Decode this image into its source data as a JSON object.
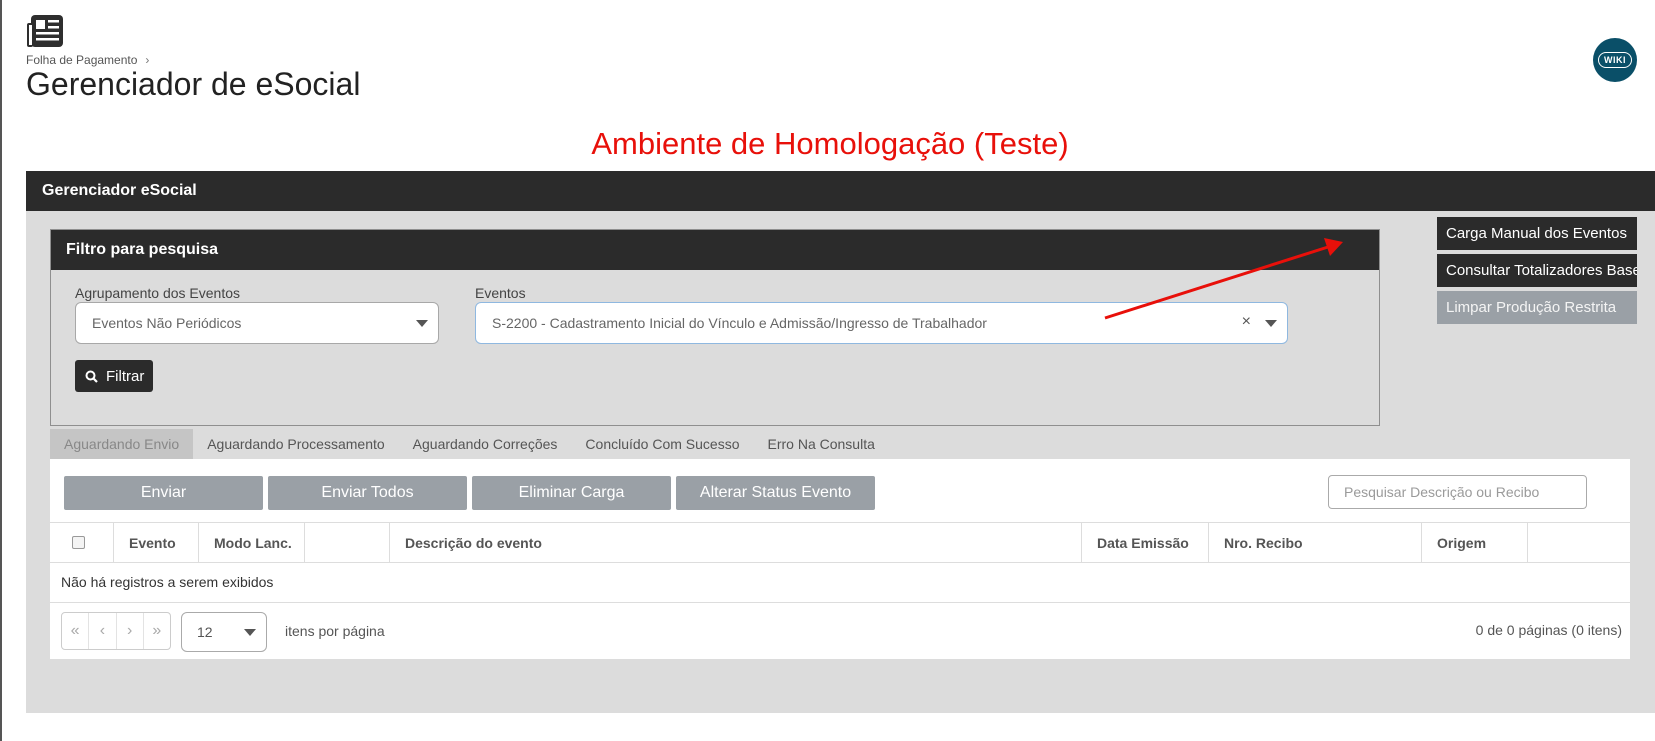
{
  "header": {
    "icon": "newspaper-icon",
    "breadcrumb": "Folha de Pagamento",
    "breadcrumb_separator": "›",
    "title": "Gerenciador de eSocial",
    "wiki_label": "WIKI"
  },
  "environment_banner": "Ambiente de Homologação (Teste)",
  "panel": {
    "title": "Gerenciador eSocial",
    "filter": {
      "title": "Filtro para pesquisa",
      "grouping_label": "Agrupamento dos Eventos",
      "grouping_value": "Eventos Não Periódicos",
      "events_label": "Eventos",
      "events_value": "S-2200 - Cadastramento Inicial do Vínculo e Admissão/Ingresso de Trabalhador",
      "clear_symbol": "×",
      "filter_button": "Filtrar"
    },
    "side_buttons": {
      "manual_load": "Carga Manual dos Eventos",
      "totalizers": "Consultar Totalizadores Base",
      "clear_restricted": "Limpar Produção Restrita"
    },
    "tabs": [
      "Aguardando Envio",
      "Aguardando Processamento",
      "Aguardando Correções",
      "Concluído Com Sucesso",
      "Erro Na Consulta"
    ],
    "actions": {
      "send": "Enviar",
      "send_all": "Enviar Todos",
      "delete_load": "Eliminar Carga",
      "change_status": "Alterar Status Evento"
    },
    "search_placeholder": "Pesquisar Descrição ou Recibo",
    "columns": {
      "event": "Evento",
      "mode": "Modo Lanc.",
      "description": "Descrição do evento",
      "emission_date": "Data Emissão",
      "receipt_number": "Nro. Recibo",
      "origin": "Origem"
    },
    "empty_message": "Não há registros a serem exibidos",
    "pager": {
      "first": "«",
      "prev": "‹",
      "next": "›",
      "last": "»",
      "page_size": "12",
      "per_page_label": "itens por página",
      "info": "0 de 0 páginas (0 itens)"
    }
  },
  "colors": {
    "dark_header": "#2b2b2b",
    "panel_bg": "#dcdcdc",
    "disabled_button": "#9aa0a6",
    "banner_red": "#e8100a",
    "arrow_red": "#e8100a",
    "wiki_bg": "#0a4f68"
  }
}
